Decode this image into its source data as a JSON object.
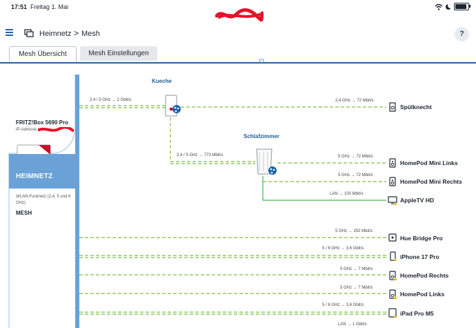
{
  "status_bar": {
    "time": "17:51",
    "date": "Freitag 1. Mai"
  },
  "header": {
    "breadcrumb": [
      {
        "label": "Heimnetz"
      },
      {
        "label": "Mesh"
      }
    ],
    "separator": ">",
    "help_label": "?"
  },
  "tabs": [
    {
      "label": "Mesh Übersicht",
      "active": true
    },
    {
      "label": "Mesh Einstellungen",
      "active": false
    }
  ],
  "home_node": {
    "name": "FRITZ!Box 5690 Pro",
    "ip_label": "IP-Adresse:",
    "block_label": "HEIMNETZ",
    "wlan_info": "WLAN-Funknetz (2,4, 5 und 6 GHz)",
    "mode": "MESH"
  },
  "repeaters": [
    {
      "room": "Kueche",
      "uplink": "2,4 / 5 GHz → 2 Gbit/s"
    },
    {
      "room": "Schlafzimmer",
      "uplink": "2,4 / 5 GHz → 773 Mbit/s"
    }
  ],
  "devices": [
    {
      "name": "Spülknecht",
      "connection": "2,4 GHz → 72 Mbit/s",
      "icon": "appliance-icon"
    },
    {
      "name": "HomePod Mini Links",
      "connection": "5 GHz → 72 Mbit/s",
      "icon": "speaker-icon"
    },
    {
      "name": "HomePod Mini Rechts",
      "connection": "5 GHz → 72 Mbit/s",
      "icon": "speaker-icon"
    },
    {
      "name": "AppleTV HD",
      "connection": "LAN → 100 Mbit/s",
      "icon": "tv-icon"
    },
    {
      "name": "Hue Bridge Pro",
      "connection": "5 GHz → 292 Mbit/s",
      "icon": "bridge-icon"
    },
    {
      "name": "iPhone 17 Pro",
      "connection": "5 / 6 GHz → 3,6 Gbit/s",
      "icon": "phone-icon"
    },
    {
      "name": "HomePod Rechts",
      "connection": "5 GHz → 7 Mbit/s",
      "icon": "speaker-icon"
    },
    {
      "name": "HomePod Links",
      "connection": "5 GHz → 7 Mbit/s",
      "icon": "speaker-icon"
    },
    {
      "name": "iPad Pro M5",
      "connection": "5 / 6 GHz → 3,6 Gbit/s",
      "icon": "tablet-icon"
    },
    {
      "name": "",
      "connection": "LAN → 1 Gbit/s",
      "icon": "lan-icon"
    }
  ],
  "colors": {
    "accent": "#1f63a8",
    "mesh_blue": "#6aa2d8",
    "wifi_green": "#7bc043",
    "lan_green": "#4caf50",
    "fritz_red": "#c8102e"
  }
}
